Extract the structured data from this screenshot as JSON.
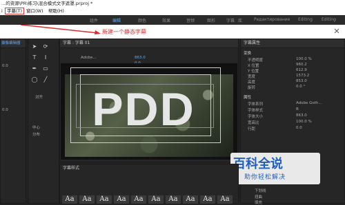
{
  "window": {
    "title": "...的资源\\PR\\练习\\混合模式文字遮罩.prproj *"
  },
  "menubar": {
    "items": [
      "i",
      "字幕(T)",
      "窗口(W)",
      "帮助(H)"
    ]
  },
  "workspace": {
    "tabs": [
      "组件",
      "编辑",
      "颜色",
      "效果",
      "音频",
      "图形",
      "字幕",
      "库",
      "Редактирование",
      "Editing",
      "Editing"
    ],
    "active": 1
  },
  "callout": {
    "text": "新建一个静态字幕"
  },
  "left_panel": {
    "title": "摄像编辑器"
  },
  "title_panel": {
    "title": "字幕 : 字幕 01",
    "font": "Adobe...",
    "size": "863.0",
    "value2": "0.0"
  },
  "tools": {
    "label_align": "对齐",
    "label_center": "中心",
    "label_distribute": "分布"
  },
  "properties": {
    "title": "字幕属性",
    "section_transform": "变换",
    "rows": [
      {
        "label": "不透明度",
        "value": "100.0 %"
      },
      {
        "label": "X 位置",
        "value": "960.2"
      },
      {
        "label": "Y 位置",
        "value": "612.9"
      },
      {
        "label": "宽度",
        "value": "1573.2"
      },
      {
        "label": "高度",
        "value": "853.0"
      },
      {
        "label": "旋转",
        "value": "0.0 °"
      }
    ],
    "section_props": "属性",
    "prop_rows": [
      {
        "label": "字体系列",
        "value": "Adobe Goth..."
      },
      {
        "label": "字体样式",
        "value": "B"
      },
      {
        "label": "字体大小",
        "value": "863.0"
      },
      {
        "label": "宽高比",
        "value": "100.0 %"
      },
      {
        "label": "行距",
        "value": "0.0"
      }
    ],
    "footer": [
      "下划线",
      "扭曲",
      "填充"
    ]
  },
  "canvas": {
    "text": "PDD"
  },
  "styles": {
    "title": "字幕样式",
    "tiles": [
      "Aa",
      "Aa",
      "Aa",
      "Aa",
      "Aa",
      "Aa",
      "Aa",
      "Aa",
      "Aa",
      "Aa"
    ]
  },
  "watermark": {
    "top": "百科全说",
    "bottom": "助你轻松解决"
  },
  "left_values": [
    "0.0",
    "0.0"
  ]
}
